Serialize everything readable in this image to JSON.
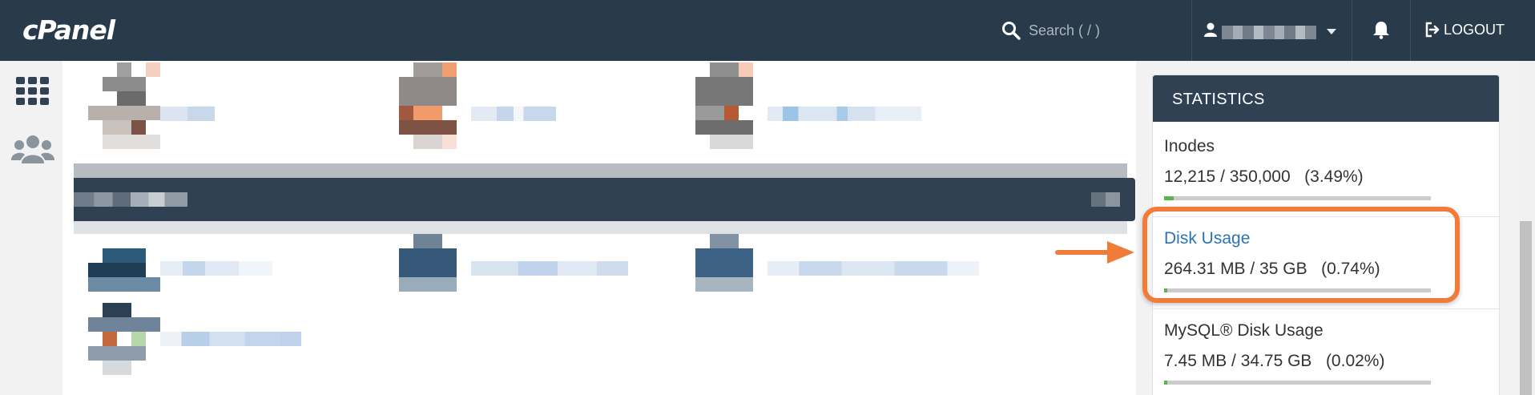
{
  "header": {
    "logo_text": "cPanel",
    "search_placeholder": "Search ( / )",
    "logout_label": "LOGOUT"
  },
  "icons": {
    "search": "search-icon",
    "user": "user-icon",
    "notifications": "bell-icon",
    "logout": "logout-icon",
    "tools": "grid-icon",
    "users": "users-icon"
  },
  "statistics": {
    "title": "STATISTICS",
    "items": [
      {
        "label": "Inodes",
        "value": "12,215 / 350,000   (3.49%)",
        "percent": 3.49,
        "link": false
      },
      {
        "label": "Disk Usage",
        "value": "264.31 MB / 35 GB   (0.74%)",
        "percent": 0.74,
        "link": true
      },
      {
        "label": "MySQL® Disk Usage",
        "value": "7.45 MB / 34.75 GB   (0.02%)",
        "percent": 0.02,
        "link": false
      }
    ]
  },
  "colors": {
    "topbar": "#293a4a",
    "panel_header": "#2f4153",
    "link": "#2b73b4",
    "progress_fill": "#55b849",
    "annotation": "#f07c3a"
  }
}
